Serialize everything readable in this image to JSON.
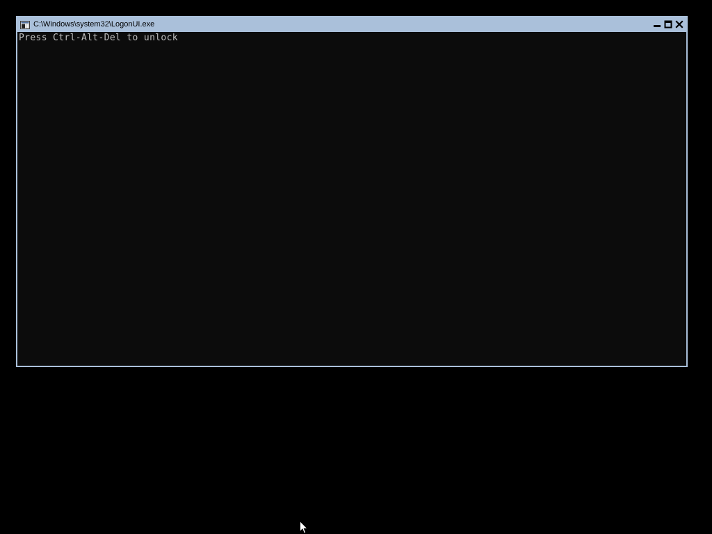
{
  "window": {
    "title": "C:\\Windows\\system32\\LogonUI.exe",
    "icon": "console-app-icon",
    "controls": [
      "minimize-icon",
      "maximize-icon",
      "close-icon"
    ]
  },
  "console": {
    "lines": [
      "Press Ctrl-Alt-Del to unlock"
    ]
  },
  "desktop": {
    "cursor": "arrow-pointer-icon"
  },
  "colors": {
    "desktop_background": "#000000",
    "window_frame": "#aac0da",
    "console_background": "#0c0c0c",
    "console_text": "#c0c0c0"
  }
}
